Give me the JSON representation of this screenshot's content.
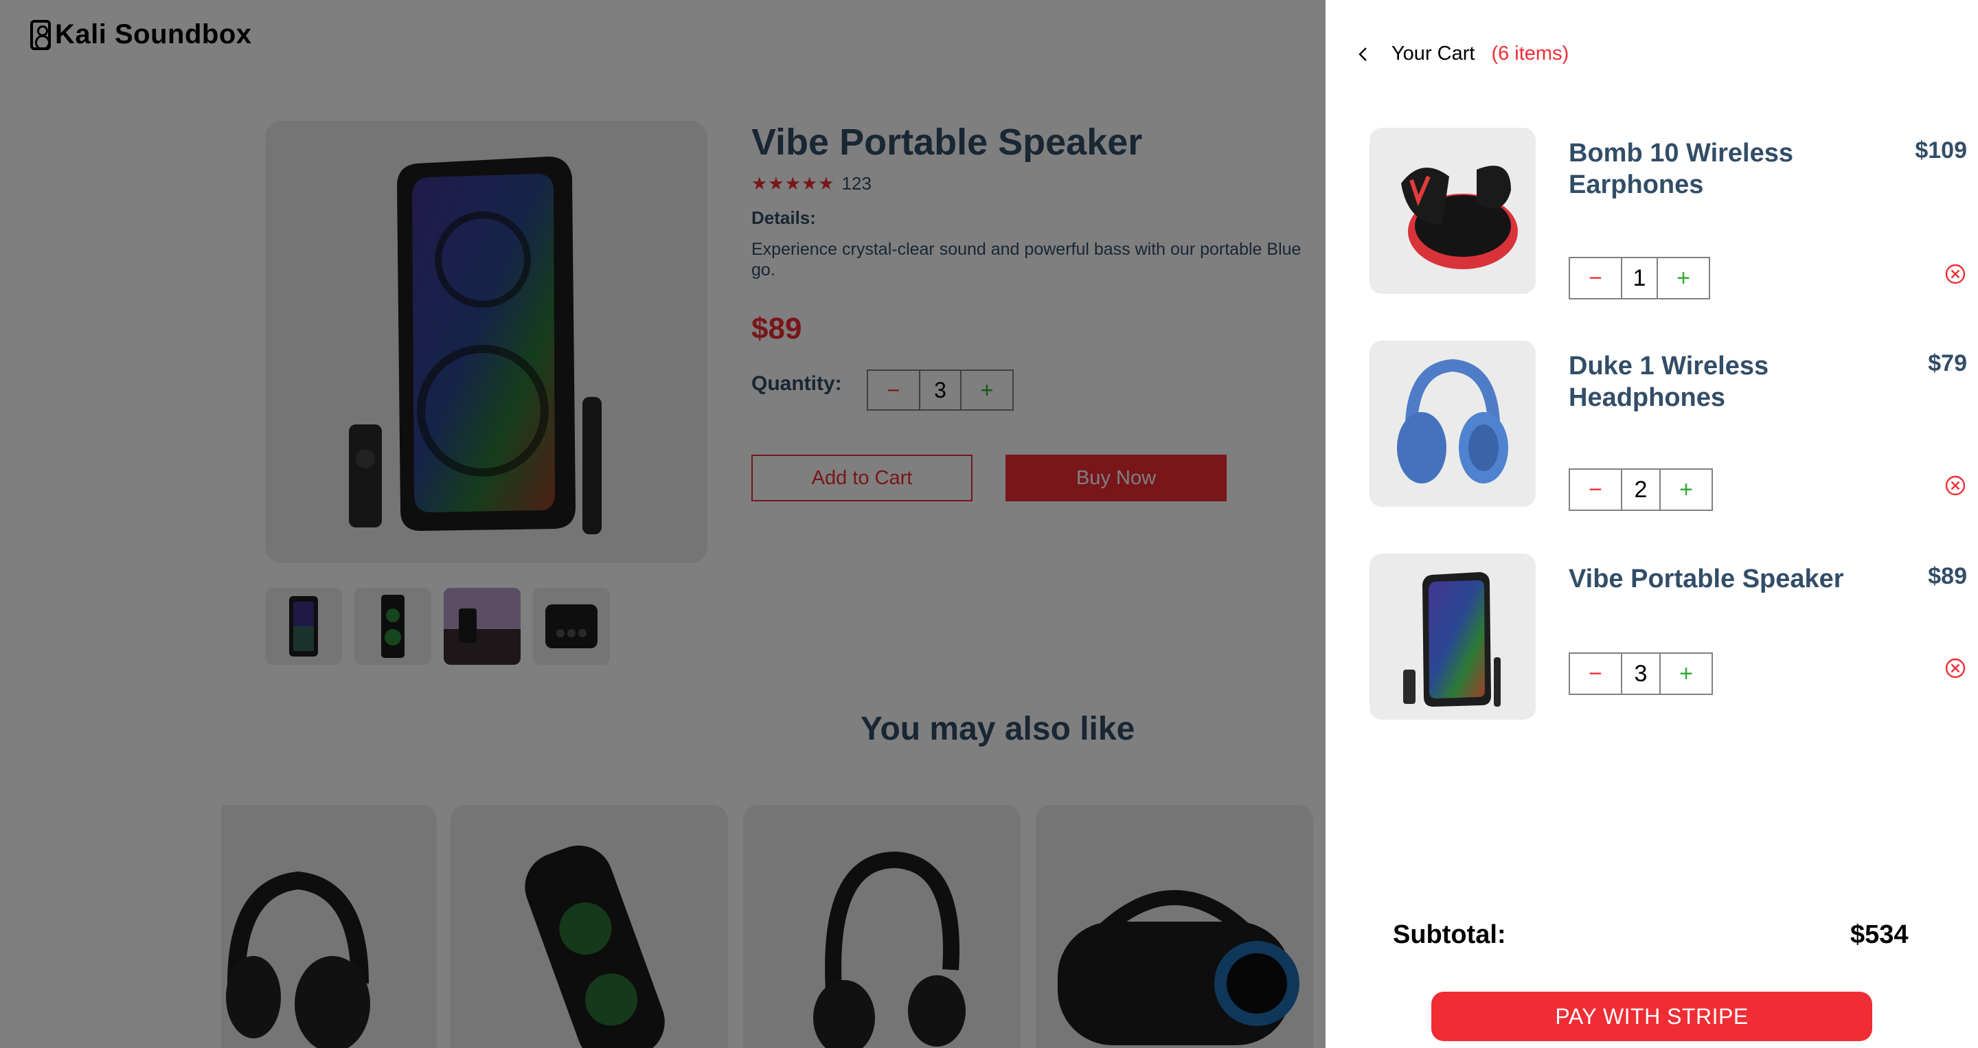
{
  "brand": {
    "name": "Kali Soundbox"
  },
  "product": {
    "title": "Vibe Portable Speaker",
    "stars": "★★★★★",
    "rating_count": "123",
    "details_label": "Details:",
    "details_line1": "Experience crystal-clear sound and powerful bass with our portable Blue",
    "details_line2": "go.",
    "price": "$89",
    "quantity_label": "Quantity:",
    "quantity": {
      "minus": "−",
      "value": "3",
      "plus": "+"
    },
    "add_to_cart": "Add to Cart",
    "buy_now": "Buy Now"
  },
  "also_like": {
    "title": "You may also like"
  },
  "cart": {
    "title": "Your Cart",
    "count": "(6 items)",
    "items": [
      {
        "name": "Bomb 10 Wireless Earphones",
        "price": "$109",
        "qty": "1",
        "minus": "−",
        "plus": "+"
      },
      {
        "name": "Duke 1 Wireless Headphones",
        "price": "$79",
        "qty": "2",
        "minus": "−",
        "plus": "+"
      },
      {
        "name": "Vibe Portable Speaker",
        "price": "$89",
        "qty": "3",
        "minus": "−",
        "plus": "+"
      }
    ],
    "subtotal_label": "Subtotal:",
    "subtotal_value": "$534",
    "pay_button": "PAY WITH STRIPE"
  },
  "colors": {
    "accent": "#f02d34",
    "heading": "#324d67",
    "plus": "#31a831",
    "tile": "#ebebeb"
  },
  "icons": [
    "speaker-logo-icon",
    "back-chevron-icon",
    "remove-item-icon",
    "star-icon"
  ]
}
